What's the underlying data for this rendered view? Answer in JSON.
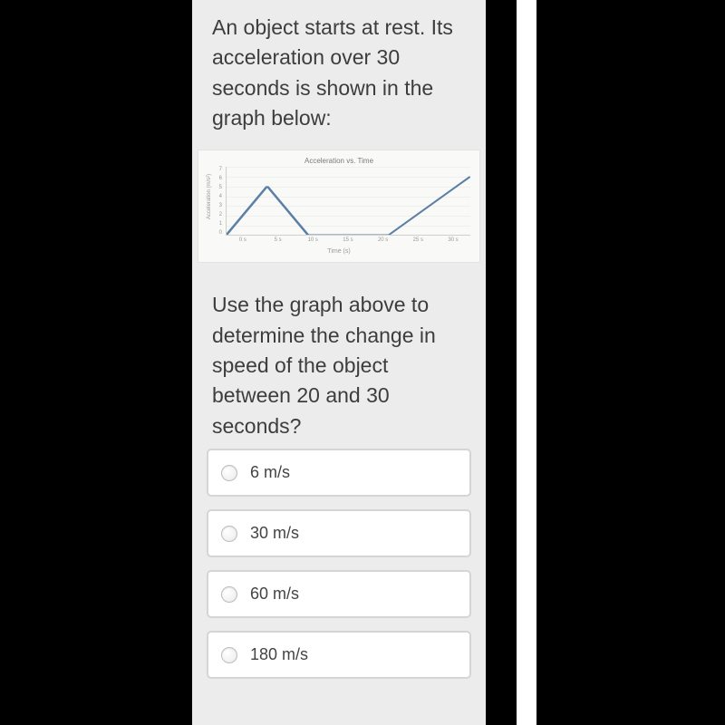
{
  "question_intro": "An object starts at rest. Its acceleration over 30 seconds is shown in the graph below:",
  "chart_data": {
    "type": "line",
    "title": "Acceleration vs. Time",
    "xlabel": "Time (s)",
    "ylabel": "Acceleration (m/s²)",
    "x_ticks": [
      "0 s",
      "5 s",
      "10 s",
      "15 s",
      "20 s",
      "25 s",
      "30 s"
    ],
    "y_ticks": [
      "7",
      "6",
      "5",
      "4",
      "3",
      "2",
      "1",
      "0"
    ],
    "ylim": [
      0,
      7
    ],
    "series": [
      {
        "name": "acceleration",
        "x": [
          0,
          5,
          10,
          15,
          20,
          30
        ],
        "values": [
          0,
          5,
          0,
          0,
          0,
          6
        ]
      }
    ]
  },
  "question_prompt": "Use the graph above to determine the change in speed of the object between 20 and 30 seconds?",
  "options": [
    {
      "label": "6 m/s"
    },
    {
      "label": "30 m/s"
    },
    {
      "label": "60 m/s"
    },
    {
      "label": "180 m/s"
    }
  ]
}
